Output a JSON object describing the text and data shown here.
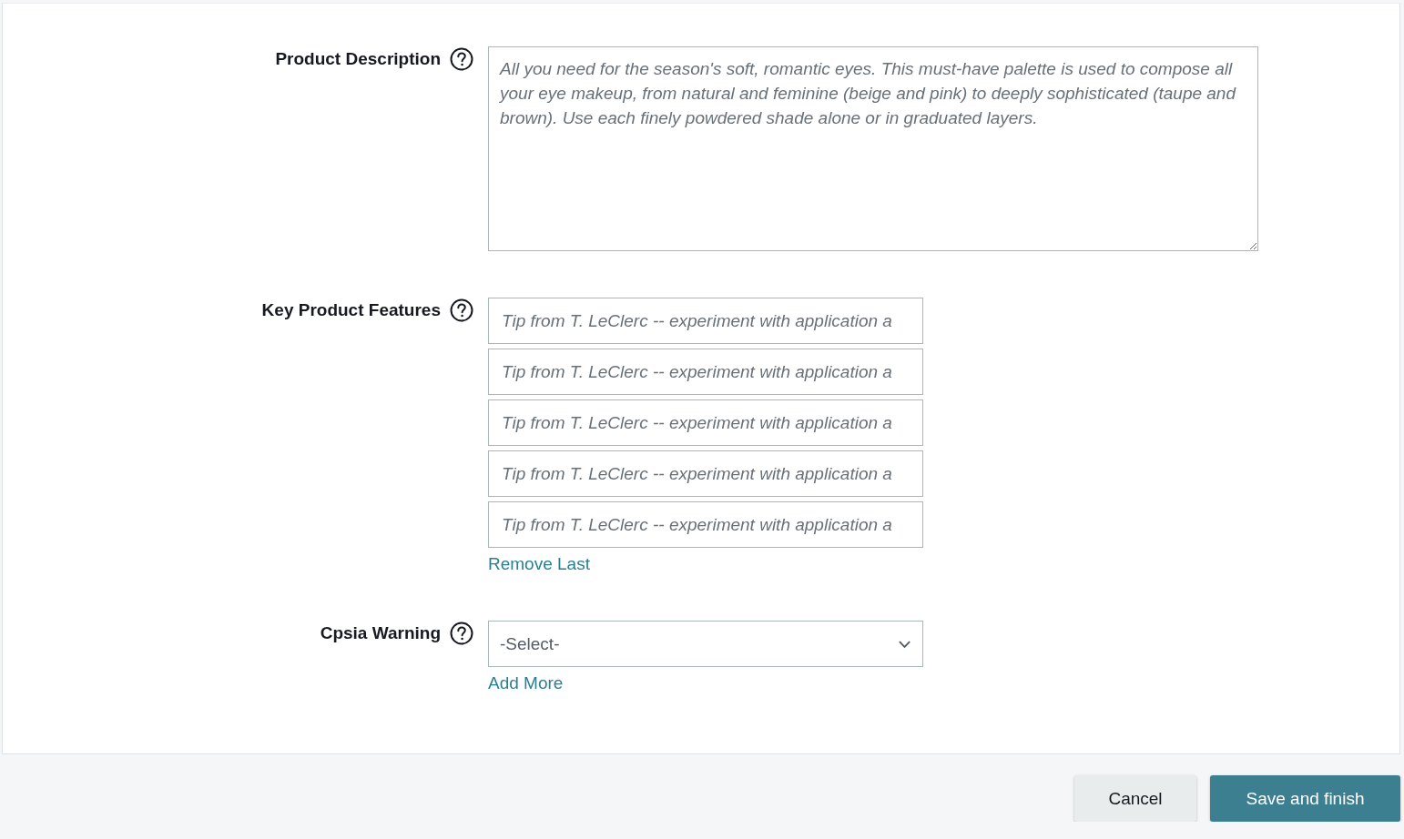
{
  "fields": [
    {
      "kind": "textarea",
      "label": "Product Description",
      "placeholder": "All you need for the season's soft, romantic eyes. This must-have palette is used to compose all your eye makeup, from natural and feminine (beige and pink) to deeply sophisticated (taupe and brown). Use each finely powdered shade alone or in graduated layers."
    },
    {
      "kind": "text-list",
      "label": "Key Product Features",
      "inputs": [
        {
          "placeholder": "Tip from T. LeClerc -- experiment with application a"
        },
        {
          "placeholder": "Tip from T. LeClerc -- experiment with application a"
        },
        {
          "placeholder": "Tip from T. LeClerc -- experiment with application a"
        },
        {
          "placeholder": "Tip from T. LeClerc -- experiment with application a"
        },
        {
          "placeholder": "Tip from T. LeClerc -- experiment with application a"
        }
      ],
      "link": "Remove Last"
    },
    {
      "kind": "select",
      "label": "Cpsia Warning",
      "value": "-Select-",
      "link": "Add More"
    }
  ],
  "buttons": [
    {
      "label": "Cancel",
      "kind": "secondary"
    },
    {
      "label": "Save and finish",
      "kind": "primary"
    }
  ]
}
